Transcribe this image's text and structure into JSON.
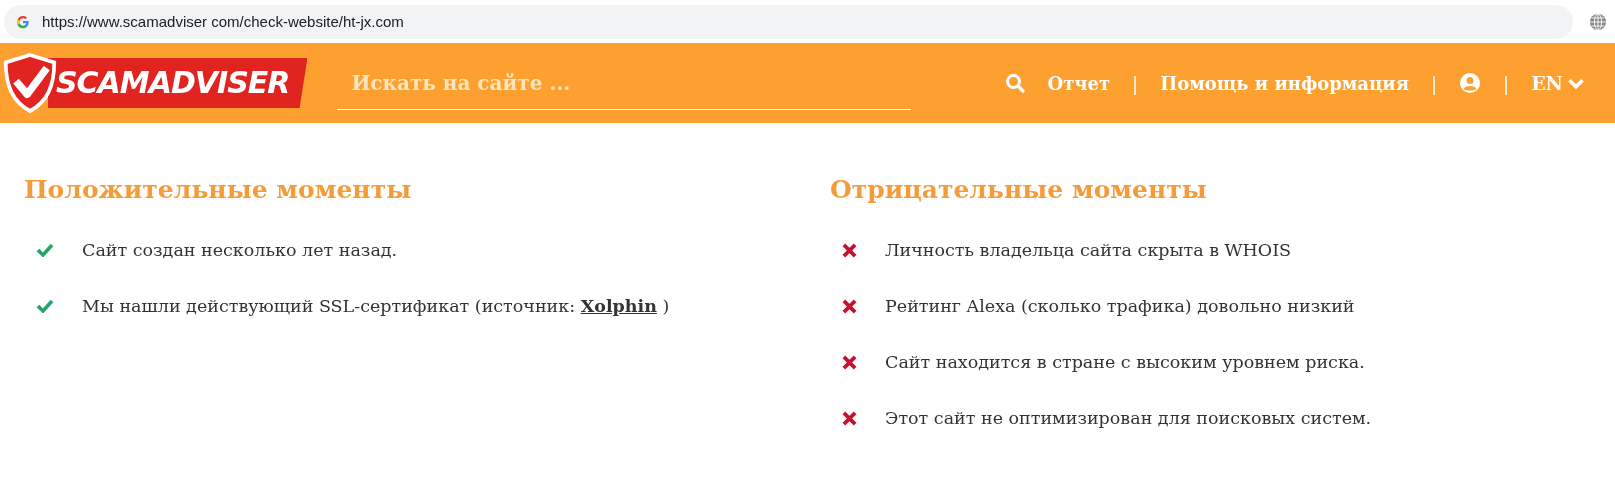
{
  "address_bar": {
    "url": "https://www.scamadviser com/check-website/ht-jx.com"
  },
  "header": {
    "logo": "SCAMADVISER",
    "search": {
      "placeholder": "Искать на сайте ..."
    },
    "nav": [
      {
        "kind": "search"
      },
      {
        "kind": "link",
        "label": "Отчет"
      },
      {
        "kind": "separator",
        "label": "|"
      },
      {
        "kind": "link",
        "label": "Помощь и информация"
      },
      {
        "kind": "separator",
        "label": "|"
      },
      {
        "kind": "account"
      },
      {
        "kind": "separator",
        "label": "|"
      },
      {
        "kind": "language",
        "label": "EN"
      }
    ]
  },
  "columns": [
    {
      "title": "Положительные моменты",
      "kind": "positive",
      "items": [
        {
          "text": "Сайт создан несколько лет назад."
        },
        {
          "text": "Мы нашли действующий SSL-сертификат (источник: ",
          "link": "Xolphin",
          "after": " )"
        }
      ]
    },
    {
      "title": "Отрицательные моменты",
      "kind": "negative",
      "items": [
        {
          "text": "Личность владельца сайта скрыта в WHOIS"
        },
        {
          "text": "Рейтинг Alexa (сколько трафика) довольно низкий"
        },
        {
          "text": "Сайт находится в стране с высоким уровнем риска."
        },
        {
          "text": "Этот сайт не оптимизирован для поисковых систем."
        }
      ]
    }
  ]
}
